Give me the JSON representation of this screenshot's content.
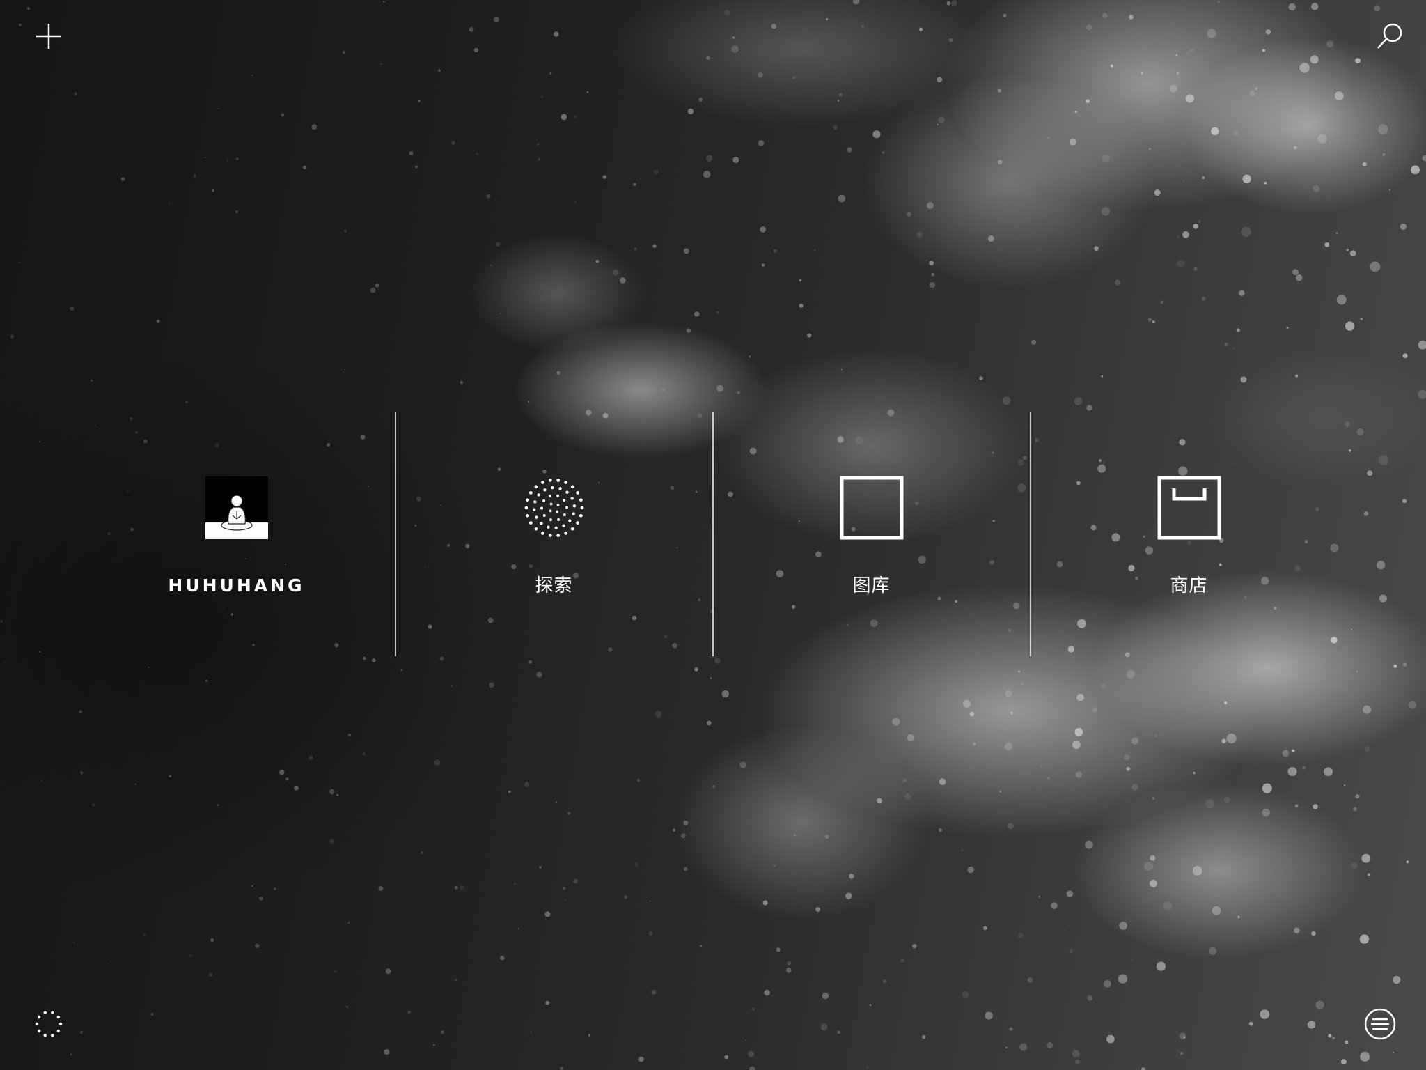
{
  "top_bar": {
    "add_icon": "plus-icon",
    "search_icon": "search-icon"
  },
  "nav": {
    "items": [
      {
        "label": "HUHUHANG",
        "icon": "avatar-meditating-figure"
      },
      {
        "label": "探索",
        "icon": "dotted-circle-icon"
      },
      {
        "label": "图库",
        "icon": "square-frame-icon"
      },
      {
        "label": "商店",
        "icon": "box-store-icon"
      }
    ]
  },
  "bottom_bar": {
    "activity_icon": "dotted-ring-icon",
    "menu_icon": "menu-lines-circle-icon"
  },
  "colors": {
    "foreground": "#ffffff",
    "background": "#1c1c1d"
  }
}
